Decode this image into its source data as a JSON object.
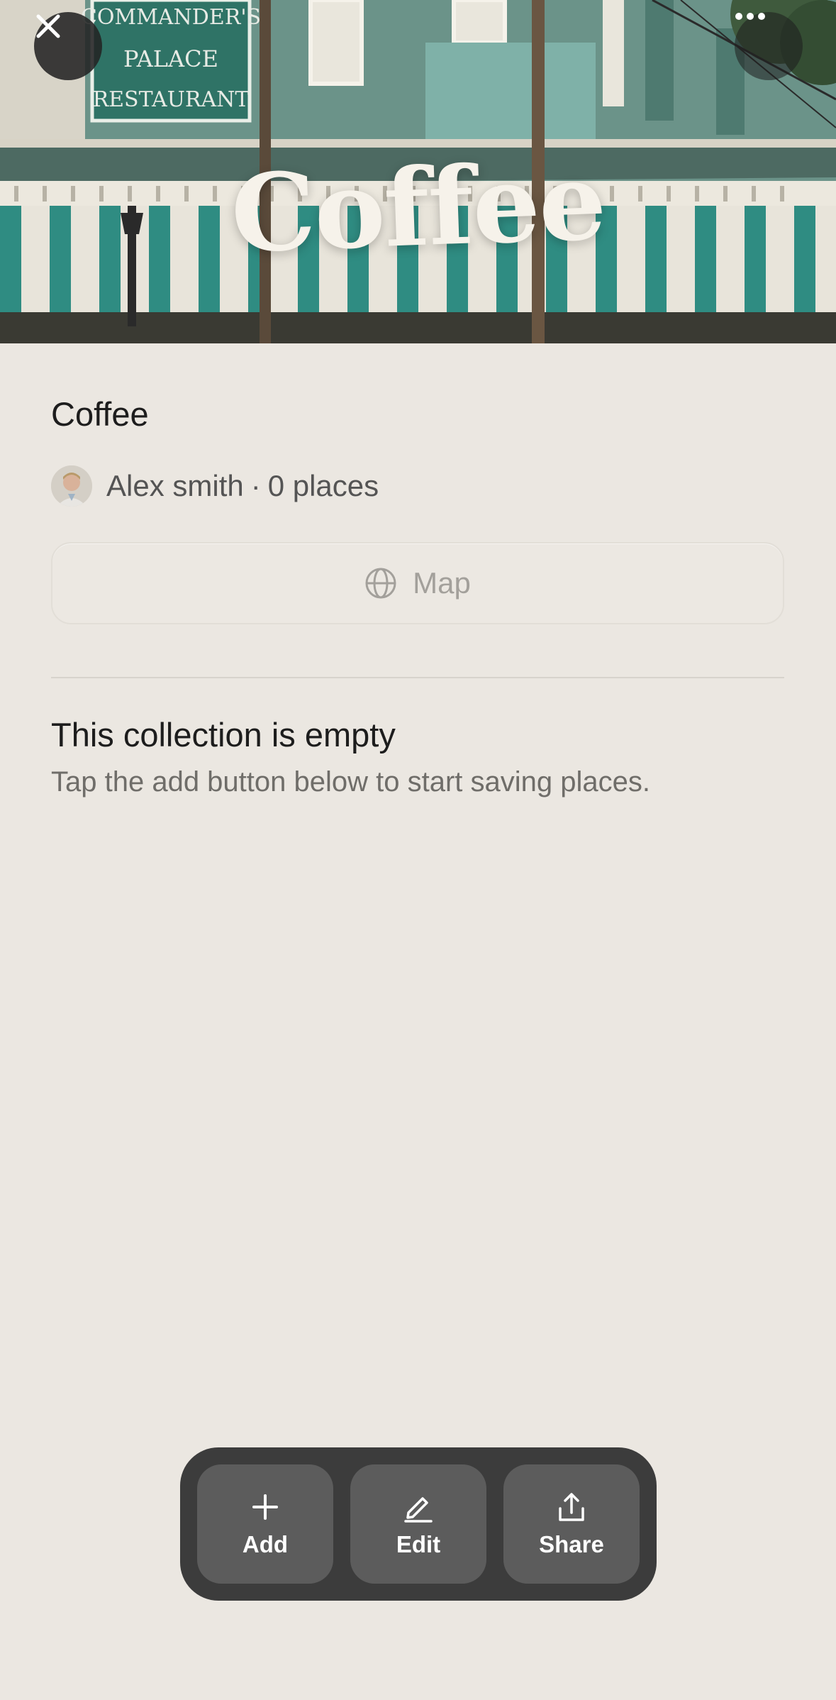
{
  "hero": {
    "title": "Coffee",
    "sign_text": [
      "COMMANDER'S",
      "PALACE",
      "RESTAURANT"
    ],
    "close_icon": "close-icon",
    "more_icon": "more-horizontal-icon"
  },
  "collection": {
    "title": "Coffee",
    "owner_name": "Alex smith",
    "separator": "·",
    "place_count": "0 places"
  },
  "map_button": {
    "label": "Map",
    "icon": "globe-icon"
  },
  "empty_state": {
    "title": "This collection is empty",
    "description": "Tap the add button below to start saving places."
  },
  "actions": [
    {
      "label": "Add",
      "icon": "plus-icon"
    },
    {
      "label": "Edit",
      "icon": "pencil-icon"
    },
    {
      "label": "Share",
      "icon": "share-icon"
    }
  ],
  "colors": {
    "background": "#ebe7e1",
    "hero_teal": "#5e8a80",
    "action_bar": "#3c3c3c",
    "action_button": "#5c5c5c"
  }
}
